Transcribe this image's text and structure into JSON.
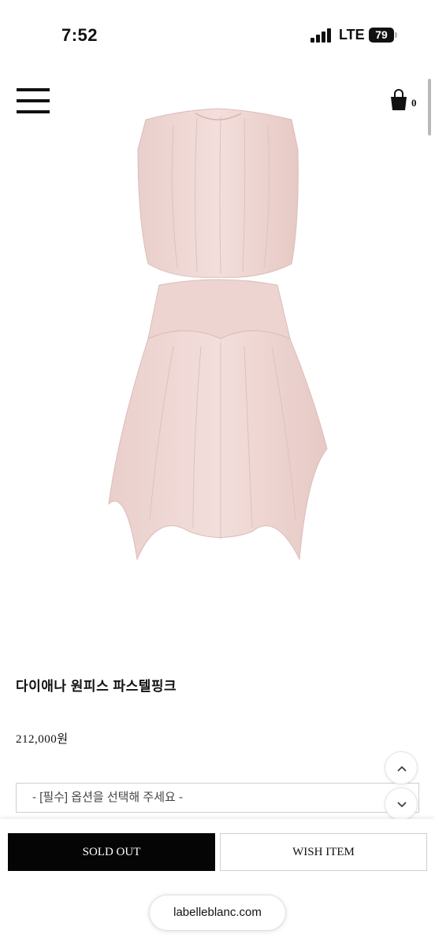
{
  "status_bar": {
    "time": "7:52",
    "network": "LTE",
    "battery": "79"
  },
  "header": {
    "cart_count": "0",
    "menu_icon": "hamburger-menu-icon",
    "cart_icon": "shopping-bag-icon"
  },
  "product": {
    "name": "다이애나 원피스 파스텔핑크",
    "price": "212,000원",
    "image_color": "#f0d9d6"
  },
  "options": {
    "placeholder": "- [필수] 옵션을 선택해 주세요 -"
  },
  "actions": {
    "sold_out_label": "SOLD OUT",
    "wish_label": "WISH ITEM"
  },
  "browser": {
    "url": "labelleblanc.com"
  }
}
